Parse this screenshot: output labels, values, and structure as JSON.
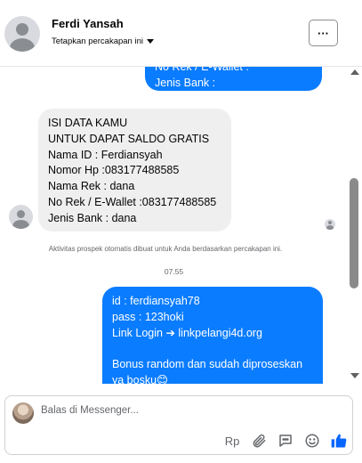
{
  "header": {
    "name": "Ferdi Yansah",
    "pin_label": "Tetapkan percakapan ini",
    "more_label": "···"
  },
  "messages": {
    "outgoing_top": [
      "No Rek / E-Wallet :",
      "Jenis Bank :"
    ],
    "incoming": [
      "ISI DATA KAMU",
      "UNTUK DAPAT SALDO GRATIS",
      "Nama ID : Ferdiansyah",
      "Nomor Hp :083177488585",
      "Nama Rek : dana",
      "No Rek / E-Wallet :083177488585",
      "Jenis Bank : dana"
    ],
    "notice": "Aktivitas prospek otomatis dibuat untuk Anda berdasarkan percakapan ini.",
    "time": "07.55",
    "outgoing_bottom": {
      "lines_a": [
        "id : ferdiansyah78",
        "pass : 123hoki",
        "Link Login ➔ linkpelangi4d.org"
      ],
      "lines_b": [
        "Bonus random dan sudah diproseskan",
        "ya bosku😊"
      ]
    }
  },
  "composer": {
    "placeholder": "Balas di Messenger...",
    "rp_label": "Rp",
    "icons": [
      "attachment-icon",
      "saved-reply-icon",
      "emoji-icon",
      "like-icon"
    ]
  },
  "colors": {
    "outgoing_bubble": "#0a7cff",
    "incoming_bubble": "#efefef",
    "accent": "#0866ff"
  }
}
